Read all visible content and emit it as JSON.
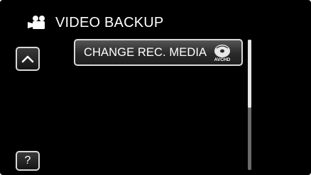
{
  "header": {
    "icon": "video-camera-icon",
    "title": "VIDEO BACKUP"
  },
  "nav": {
    "up_icon": "chevron-up-icon"
  },
  "menu": {
    "items": [
      {
        "label": "CHANGE REC. MEDIA",
        "icon": "avchd-disc-icon",
        "icon_text": "AVCHD"
      }
    ]
  },
  "scrollbar": {
    "position": 0,
    "visible_fraction": 0.52
  },
  "help": {
    "label": "?"
  },
  "colors": {
    "background": "#000000",
    "text": "#ffffff",
    "button_border": "#d9d9d9"
  }
}
